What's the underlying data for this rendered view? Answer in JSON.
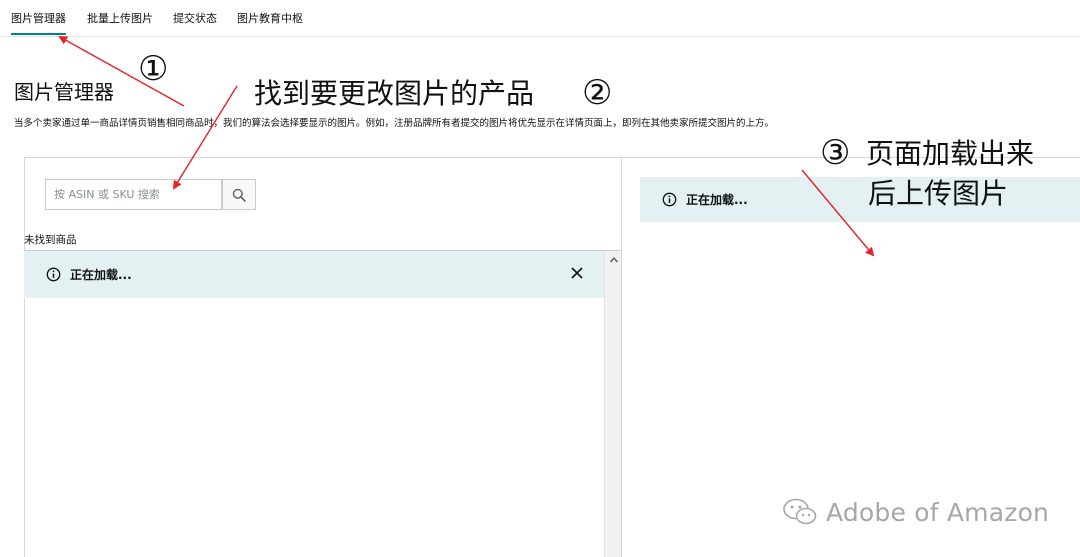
{
  "tabs": [
    {
      "label": "图片管理器",
      "active": true
    },
    {
      "label": "批量上传图片",
      "active": false
    },
    {
      "label": "提交状态",
      "active": false
    },
    {
      "label": "图片教育中枢",
      "active": false
    }
  ],
  "page": {
    "title": "图片管理器",
    "description": "当多个卖家通过单一商品详情页销售相同商品时，我们的算法会选择要显示的图片。例如，注册品牌所有者提交的图片将优先显示在详情页面上，即列在其他卖家所提交图片的上方。"
  },
  "left_panel": {
    "search_placeholder": "按 ASIN 或 SKU 搜索",
    "search_icon": "search-icon",
    "not_found": "未找到商品",
    "loading": "正在加载..."
  },
  "right_panel": {
    "loading": "正在加载..."
  },
  "annotations": {
    "step1_num": "①",
    "step2_text": "找到要更改图片的产品",
    "step2_num": "②",
    "step3_num": "③",
    "step3_line1": "页面加载出来",
    "step3_line2": "后上传图片",
    "arrow_color": "#e8202a"
  },
  "watermark": {
    "text": "Adobe of Amazon",
    "icon": "wechat-icon"
  }
}
